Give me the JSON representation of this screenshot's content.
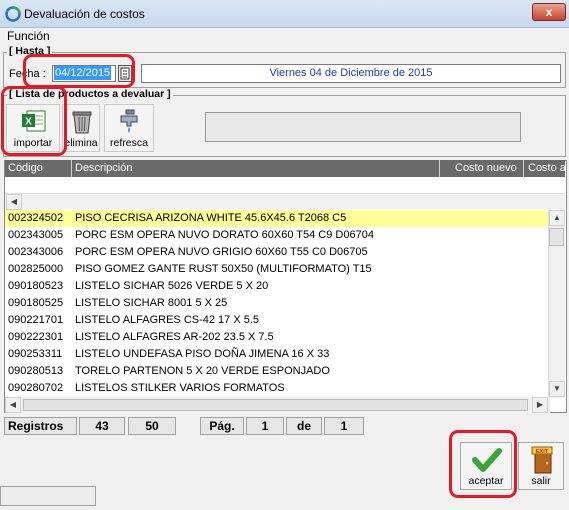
{
  "window": {
    "title": "Devaluación de costos",
    "close_glyph": "x"
  },
  "menu": {
    "funcion": "Función"
  },
  "hasta": {
    "group_title": "[ Hasta ]",
    "fecha_label": "Fecha :",
    "fecha_value": "04/12/2015",
    "fecha_long": "Viernes 04 de Diciembre de 2015"
  },
  "lista": {
    "group_title": "[ Lista de productos a devaluar ]",
    "importar_label": "importar",
    "elimina_label": "elimina",
    "refresca_label": "refresca"
  },
  "grid": {
    "columns": [
      "Código",
      "Descripción",
      "Costo nuevo",
      "Costo a"
    ],
    "rows": [
      {
        "code": "002324502",
        "desc": "PISO CECRISA ARIZONA WHITE 45.6X45.6 T2068 C5",
        "selected": true
      },
      {
        "code": "002343005",
        "desc": "PORC ESM OPERA NUVO DORATO 60X60 T54 C9 D06704"
      },
      {
        "code": "002343006",
        "desc": "PORC ESM OPERA NUVO GRIGIO 60X60 T55 C0 D06705"
      },
      {
        "code": "002825000",
        "desc": "PISO GOMEZ GANTE RUST 50X50  (MULTIFORMATO) T15"
      },
      {
        "code": "090180523",
        "desc": "LISTELO SICHAR 5026 VERDE 5 X 20"
      },
      {
        "code": "090180525",
        "desc": "LISTELO SICHAR 8001 5 X 25"
      },
      {
        "code": "090221701",
        "desc": "LISTELO ALFAGRES CS-42 17 X 5.5"
      },
      {
        "code": "090222301",
        "desc": "LISTELO ALFAGRES AR-202  23.5 X 7.5"
      },
      {
        "code": "090253311",
        "desc": "LISTELO UNDEFASA PISO DOÑA JIMENA 16 X 33"
      },
      {
        "code": "090280513",
        "desc": "TORELO PARTENON 5 X 20 VERDE ESPONJADO"
      },
      {
        "code": "090280702",
        "desc": "LISTELOS STILKER VARIOS FORMATOS"
      }
    ]
  },
  "status": {
    "registros_label": "Registros",
    "registros_shown": "43",
    "registros_total": "50",
    "pag_label": "Pág.",
    "pag_current": "1",
    "de_label": "de",
    "pag_total": "1"
  },
  "actions": {
    "aceptar_label": "aceptar",
    "salir_label": "salir",
    "salir_sign": "EXIT"
  },
  "colors": {
    "selected_row": "#ffff99",
    "header_bg": "#6a6a6a",
    "highlight": "#e01b24",
    "date_blue": "#1a3cb0"
  }
}
